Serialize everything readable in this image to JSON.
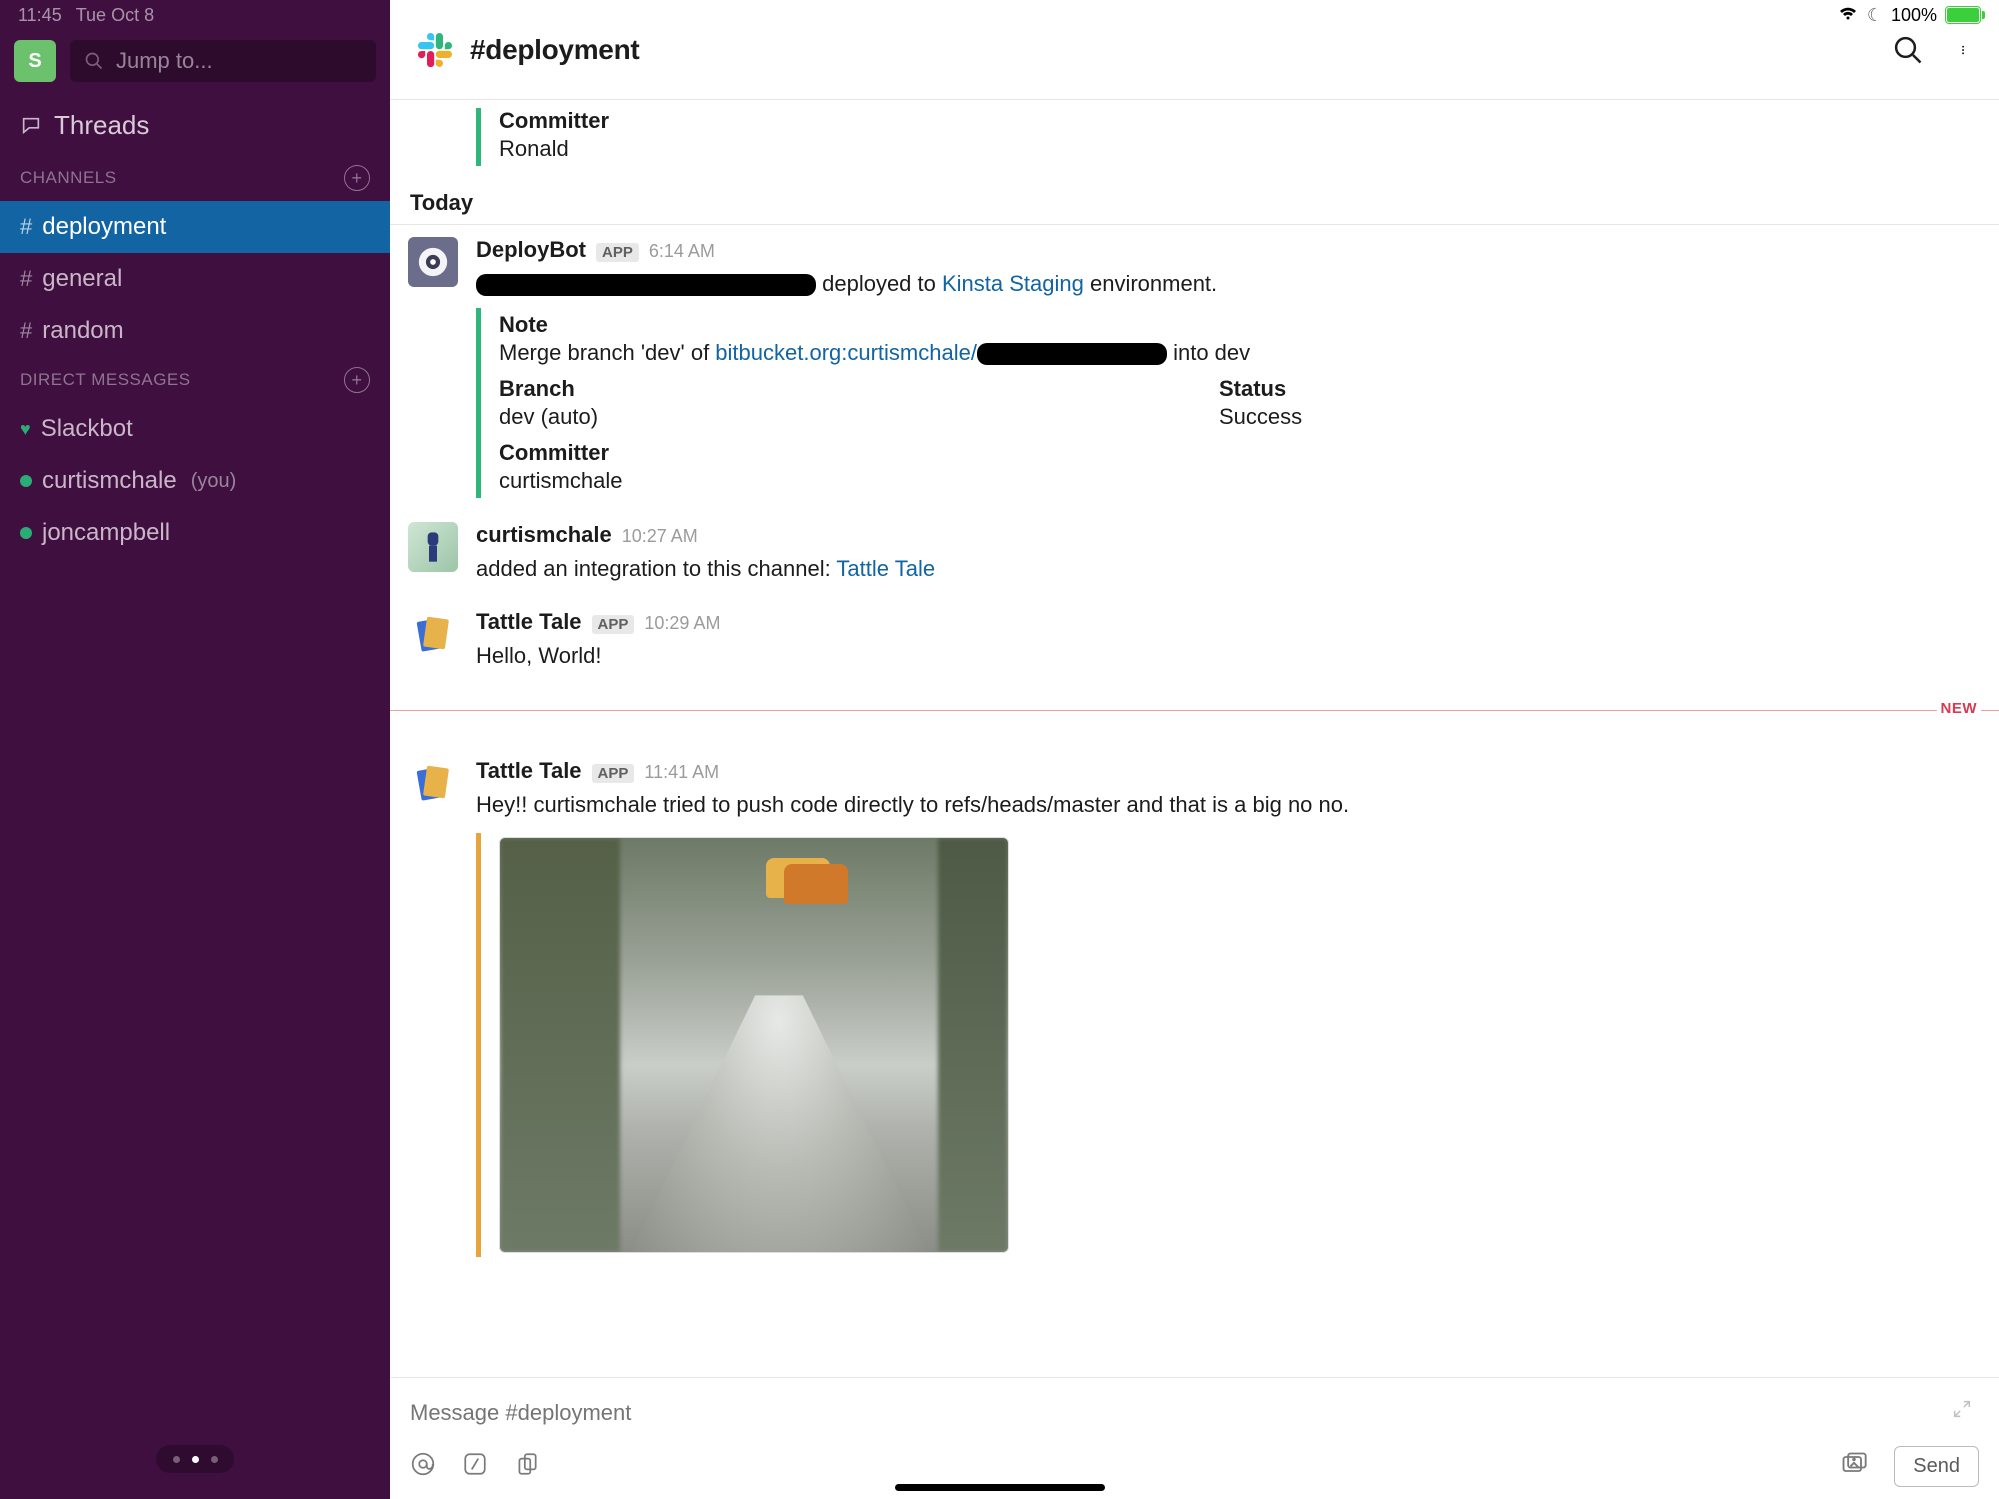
{
  "statusbar": {
    "time": "11:45",
    "date": "Tue Oct 8",
    "battery_pct": "100%"
  },
  "sidebar": {
    "workspace_initial": "S",
    "jump_placeholder": "Jump to...",
    "threads_label": "Threads",
    "channels_header": "CHANNELS",
    "dms_header": "DIRECT MESSAGES",
    "channels": [
      {
        "name": "deployment",
        "active": true
      },
      {
        "name": "general",
        "active": false
      },
      {
        "name": "random",
        "active": false
      }
    ],
    "dms": [
      {
        "name": "Slackbot",
        "heart": true
      },
      {
        "name": "curtismchale",
        "you": true
      },
      {
        "name": "joncampbell"
      }
    ],
    "you_label": "(you)"
  },
  "header": {
    "channel_title": "#deployment"
  },
  "divider_today": "Today",
  "new_label": "NEW",
  "prev_attach": {
    "committer_label": "Committer",
    "committer_value": "Ronald"
  },
  "messages": {
    "deploybot": {
      "name": "DeployBot",
      "app": "APP",
      "time": "6:14 AM",
      "text_deployed": " deployed to ",
      "text_link_env": "Kinsta Staging",
      "text_env_suffix": " environment.",
      "note_label": "Note",
      "note_prefix": "Merge branch 'dev' of ",
      "note_link": "bitbucket.org:curtismchale/",
      "note_suffix": " into dev",
      "branch_label": "Branch",
      "branch_value": "dev (auto)",
      "status_label": "Status",
      "status_value": "Success",
      "committer_label": "Committer",
      "committer_value": "curtismchale"
    },
    "curtis_integration": {
      "name": "curtismchale",
      "time": "10:27 AM",
      "text_prefix": "added an integration to this channel: ",
      "text_link": "Tattle Tale"
    },
    "tattle_hello": {
      "name": "Tattle Tale",
      "app": "APP",
      "time": "10:29 AM",
      "text": "Hello, World!"
    },
    "tattle_alert": {
      "name": "Tattle Tale",
      "app": "APP",
      "time": "11:41 AM",
      "text": "Hey!! curtismchale tried to push code directly to refs/heads/master and that is a big no no."
    }
  },
  "composer": {
    "placeholder": "Message #deployment",
    "send_label": "Send"
  }
}
